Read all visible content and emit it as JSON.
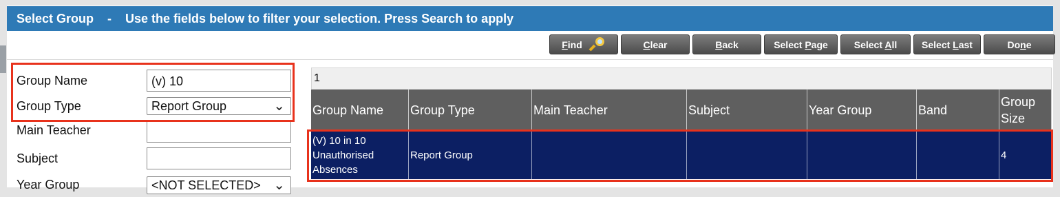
{
  "title": {
    "main": "Select Group",
    "separator": "-",
    "subtitle": "Use the fields below to filter your selection. Press Search to apply"
  },
  "buttons": [
    {
      "pre": "",
      "u": "F",
      "post": "ind",
      "name": "find-button",
      "icon": "magnifier-icon"
    },
    {
      "pre": "",
      "u": "C",
      "post": "lear",
      "name": "clear-button"
    },
    {
      "pre": "",
      "u": "B",
      "post": "ack",
      "name": "back-button"
    },
    {
      "pre": "Select ",
      "u": "P",
      "post": "age",
      "name": "select-page-button"
    },
    {
      "pre": "Select ",
      "u": "A",
      "post": "ll",
      "name": "select-all-button"
    },
    {
      "pre": "Select ",
      "u": "L",
      "post": "ast",
      "name": "select-last-button"
    },
    {
      "pre": "Do",
      "u": "n",
      "post": "e",
      "name": "done-button"
    }
  ],
  "filters": {
    "group_name": {
      "label": "Group Name",
      "value": "(v) 10"
    },
    "group_type": {
      "label": "Group Type",
      "value": "Report Group"
    },
    "main_teacher": {
      "label": "Main Teacher",
      "value": ""
    },
    "subject": {
      "label": "Subject",
      "value": ""
    },
    "year_group": {
      "label": "Year Group",
      "value": "<NOT SELECTED>"
    }
  },
  "pager": {
    "page": "1"
  },
  "table": {
    "columns": [
      "Group Name",
      "Group Type",
      "Main Teacher",
      "Subject",
      "Year Group",
      "Band",
      "Group Size"
    ],
    "rows": [
      [
        "(V) 10 in 10 Unauthorised Absences",
        "Report Group",
        "",
        "",
        "",
        "",
        "4"
      ]
    ]
  },
  "colors": {
    "title_bar": "#2e7ab6",
    "header_row": "#5f5f5f",
    "selected_row": "#0c1f63",
    "highlight_box": "#e8321c"
  }
}
